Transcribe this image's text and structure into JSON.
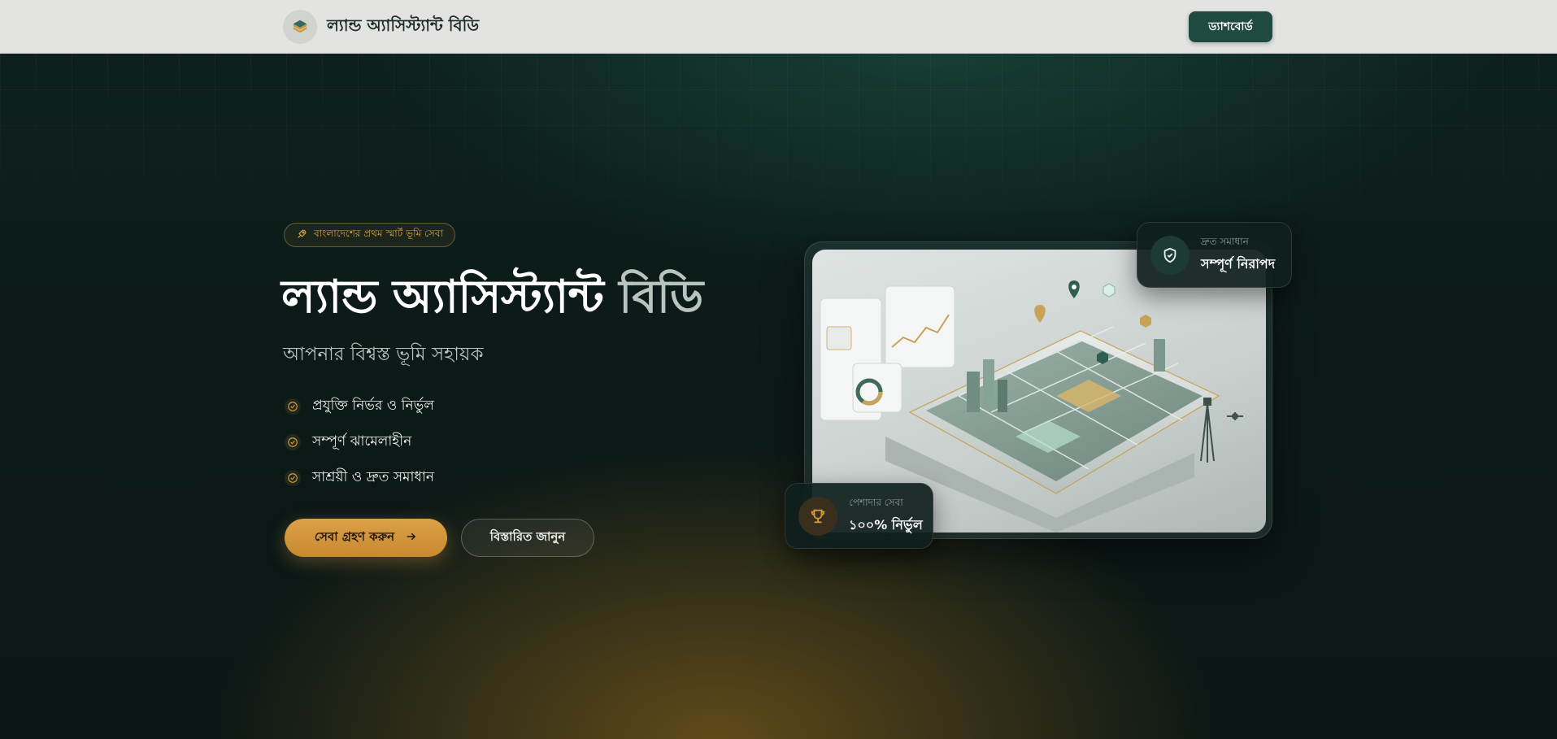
{
  "header": {
    "brand_name": "ল্যান্ড অ্যাসিস্ট্যান্ট বিডি",
    "dashboard_label": "ড্যাশবোর্ড"
  },
  "hero": {
    "badge": "বাংলাদেশের প্রথম স্মার্ট ভূমি সেবা",
    "title_part1": "ল্যান্ড অ্যাসিস্ট্যান্ট",
    "title_part2": "বিডি",
    "subtitle": "আপনার বিশ্বস্ত ভূমি সহায়ক",
    "features": [
      "প্রযুক্তি নির্ভর ও নির্ভুল",
      "সম্পূর্ণ ঝামেলাহীন",
      "সাশ্রয়ী ও দ্রুত সমাধান"
    ],
    "primary_cta": "সেবা গ্রহণ করুন",
    "secondary_cta": "বিস্তারিত জানুন"
  },
  "cards": {
    "top": {
      "label": "দ্রুত সমাধান",
      "value": "সম্পূর্ণ নিরাপদ"
    },
    "bottom": {
      "label": "পেশাদার সেবা",
      "value": "১০০% নির্ভুল"
    }
  },
  "icons": {
    "brand": "layers-logo-icon",
    "badge": "rocket-icon",
    "feature": "check-circle-icon",
    "cta": "arrow-right-icon",
    "top_card": "shield-check-icon",
    "bottom_card": "trophy-icon"
  },
  "colors": {
    "accent_gold": "#d39a3e",
    "brand_green": "#1f4a40",
    "background": "#0b1917"
  }
}
